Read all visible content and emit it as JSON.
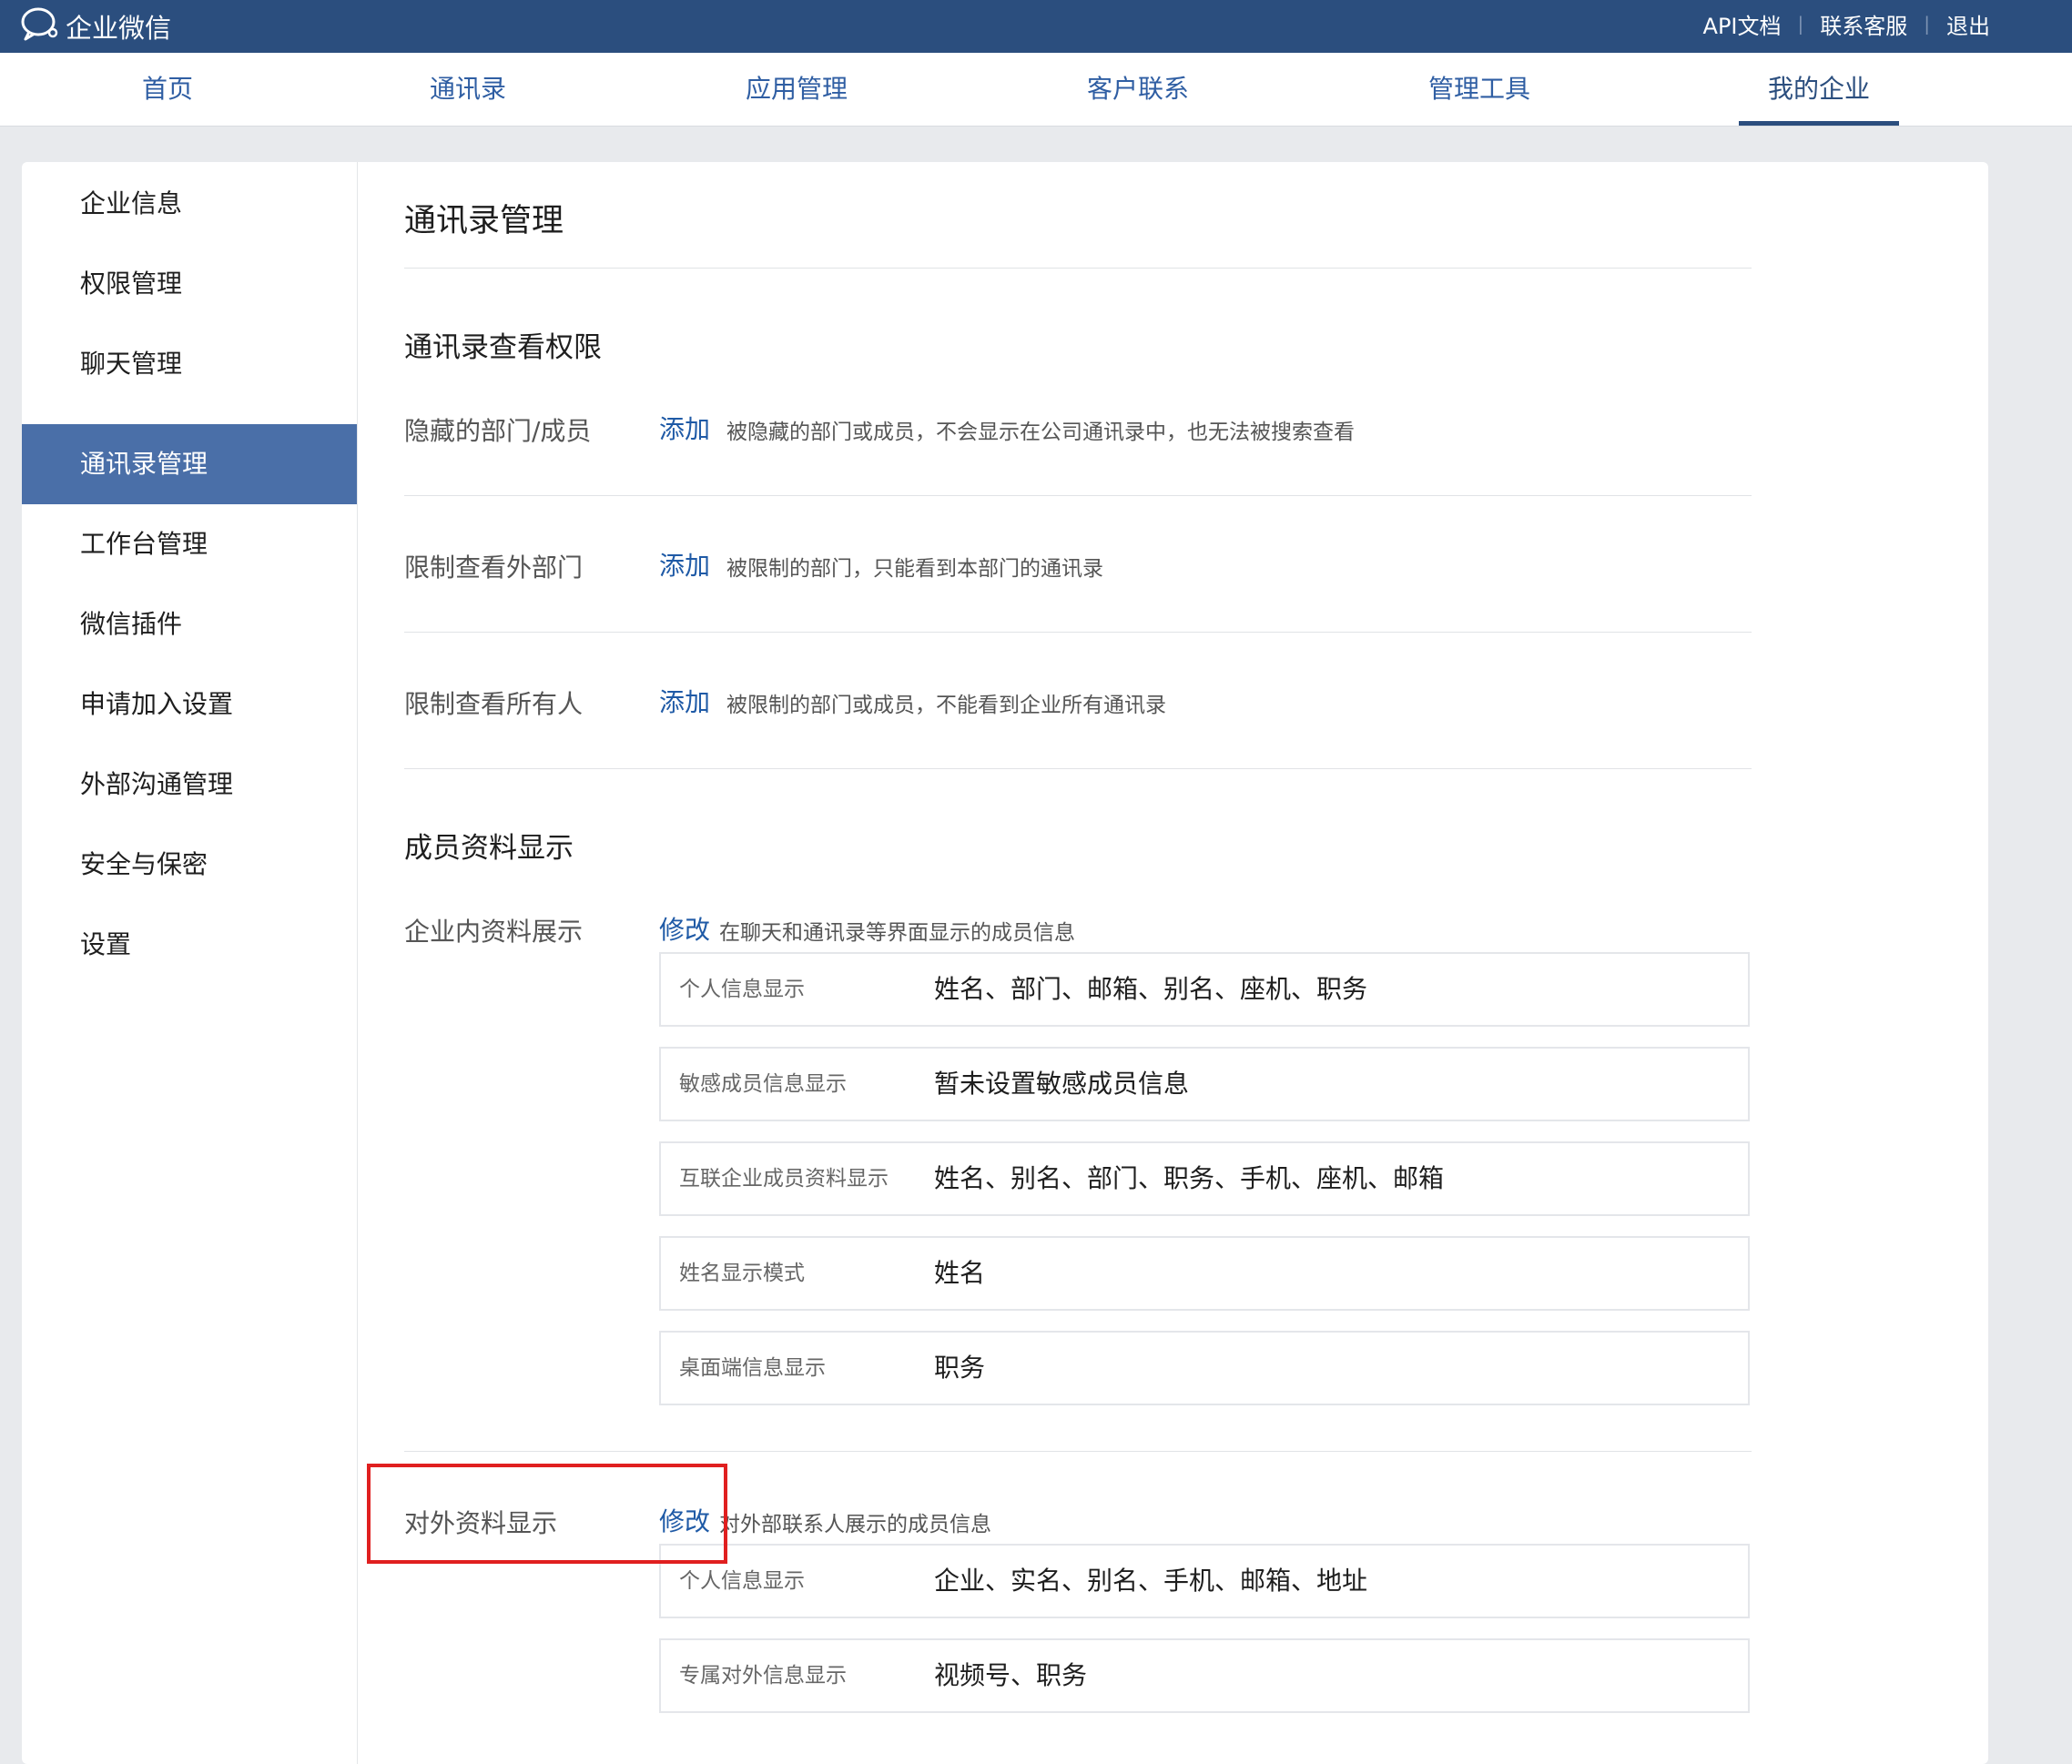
{
  "header": {
    "logo_text": "企业微信",
    "links": [
      "API文档",
      "联系客服",
      "退出"
    ]
  },
  "nav": {
    "tabs": [
      "首页",
      "通讯录",
      "应用管理",
      "客户联系",
      "管理工具",
      "我的企业"
    ],
    "active": "我的企业"
  },
  "sidebar": {
    "items": [
      "企业信息",
      "权限管理",
      "聊天管理",
      "通讯录管理",
      "工作台管理",
      "微信插件",
      "申请加入设置",
      "外部沟通管理",
      "安全与保密",
      "设置"
    ],
    "active": "通讯录管理"
  },
  "main": {
    "title": "通讯录管理",
    "view_permissions": {
      "heading": "通讯录查看权限",
      "rows": [
        {
          "label": "隐藏的部门/成员",
          "action": "添加",
          "desc": "被隐藏的部门或成员，不会显示在公司通讯录中，也无法被搜索查看"
        },
        {
          "label": "限制查看外部门",
          "action": "添加",
          "desc": "被限制的部门，只能看到本部门的通讯录"
        },
        {
          "label": "限制查看所有人",
          "action": "添加",
          "desc": "被限制的部门或成员，不能看到企业所有通讯录"
        }
      ]
    },
    "member_display": {
      "heading": "成员资料显示",
      "internal": {
        "label": "企业内资料展示",
        "action": "修改",
        "desc": "在聊天和通讯录等界面显示的成员信息",
        "items": [
          {
            "key": "个人信息显示",
            "value": "姓名、部门、邮箱、别名、座机、职务"
          },
          {
            "key": "敏感成员信息显示",
            "value": "暂未设置敏感成员信息"
          },
          {
            "key": "互联企业成员资料显示",
            "value": "姓名、别名、部门、职务、手机、座机、邮箱"
          },
          {
            "key": "姓名显示模式",
            "value": "姓名"
          },
          {
            "key": "桌面端信息显示",
            "value": "职务"
          }
        ]
      },
      "external": {
        "label": "对外资料显示",
        "action": "修改",
        "desc": "对外部联系人展示的成员信息",
        "items": [
          {
            "key": "个人信息显示",
            "value": "企业、实名、别名、手机、邮箱、地址"
          },
          {
            "key": "专属对外信息显示",
            "value": "视频号、职务"
          }
        ]
      }
    }
  }
}
